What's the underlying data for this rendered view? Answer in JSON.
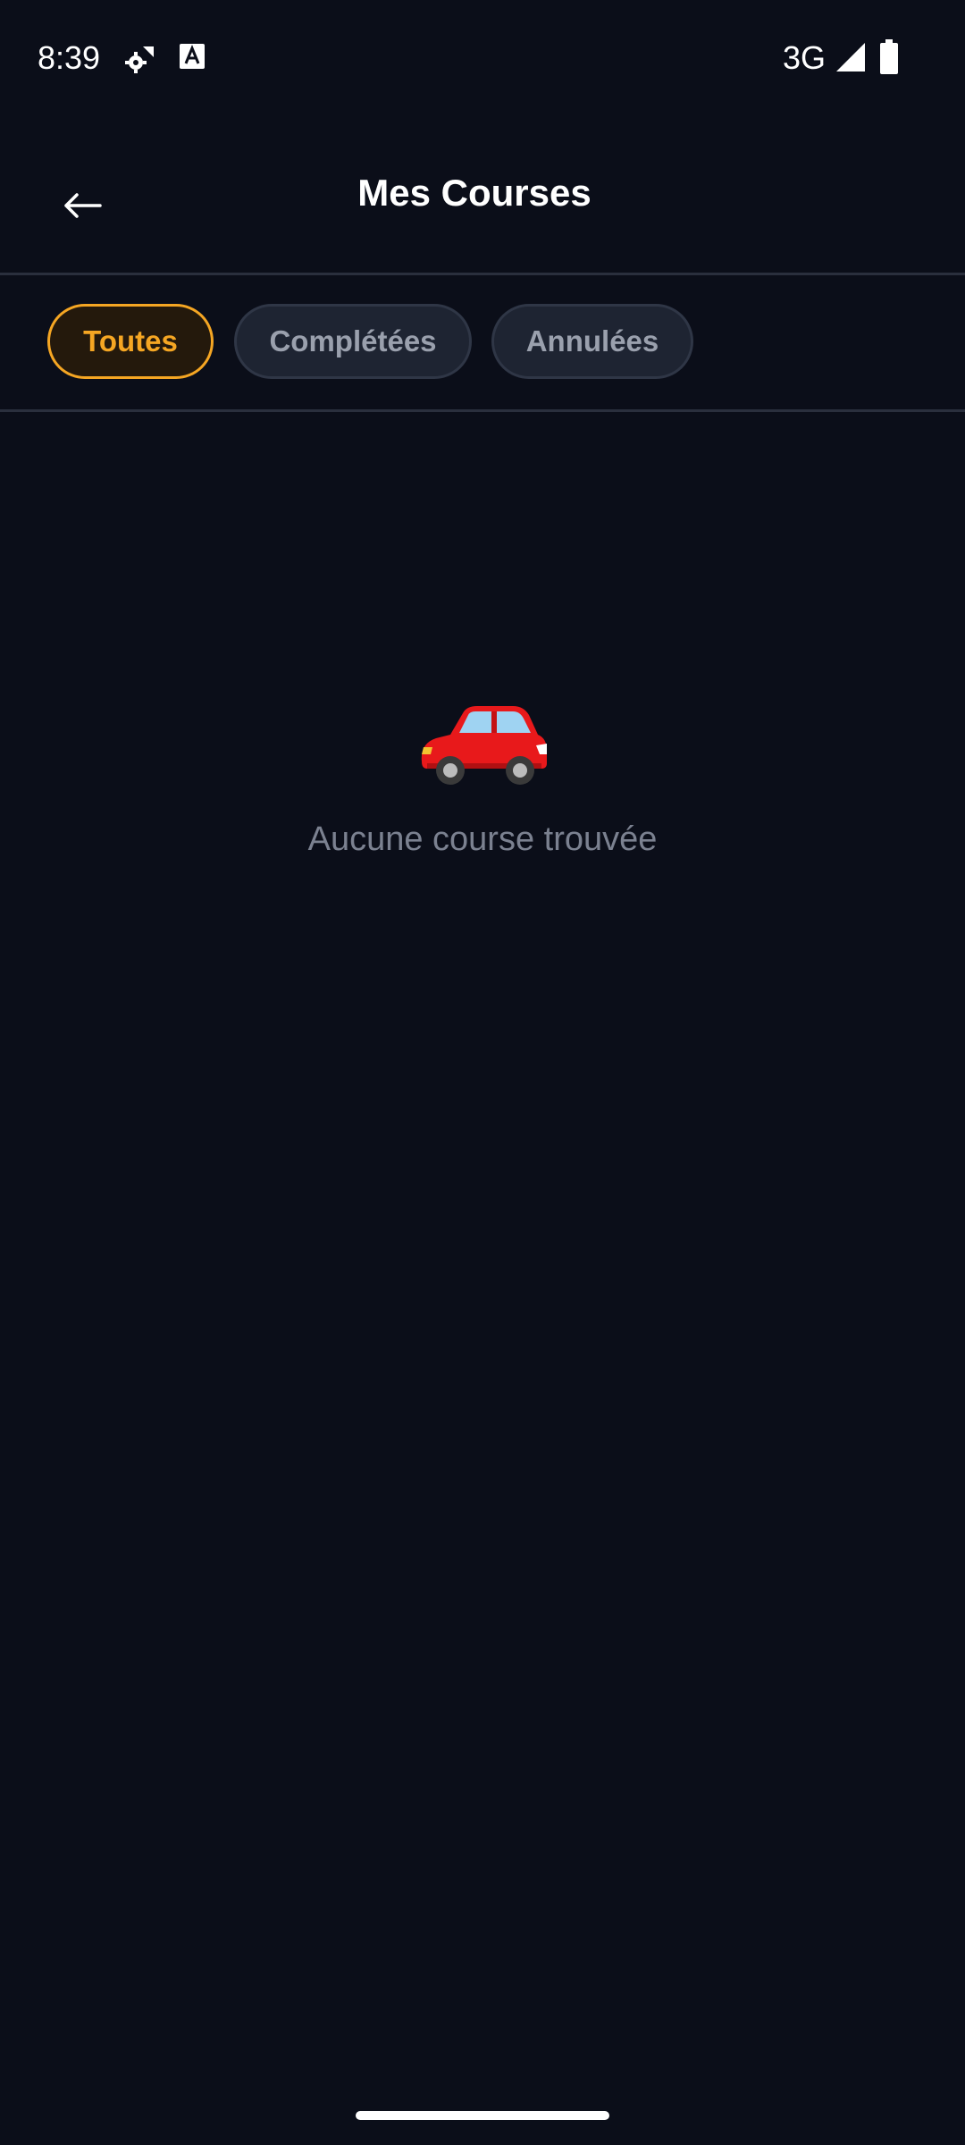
{
  "status_bar": {
    "time": "8:39",
    "network": "3G",
    "icons": [
      "settings-sync-icon",
      "text-a-icon",
      "signal-icon",
      "battery-icon"
    ]
  },
  "header": {
    "title": "Mes Courses",
    "back_icon": "arrow-left-icon"
  },
  "tabs": [
    {
      "label": "Toutes",
      "active": true
    },
    {
      "label": "Complétées",
      "active": false
    },
    {
      "label": "Annulées",
      "active": false
    }
  ],
  "empty_state": {
    "icon": "car-icon",
    "message": "Aucune course trouvée"
  },
  "colors": {
    "background": "#0b0e19",
    "accent": "#f5a623",
    "tab_inactive_bg": "#1e2432",
    "muted_text": "#7b8190"
  }
}
